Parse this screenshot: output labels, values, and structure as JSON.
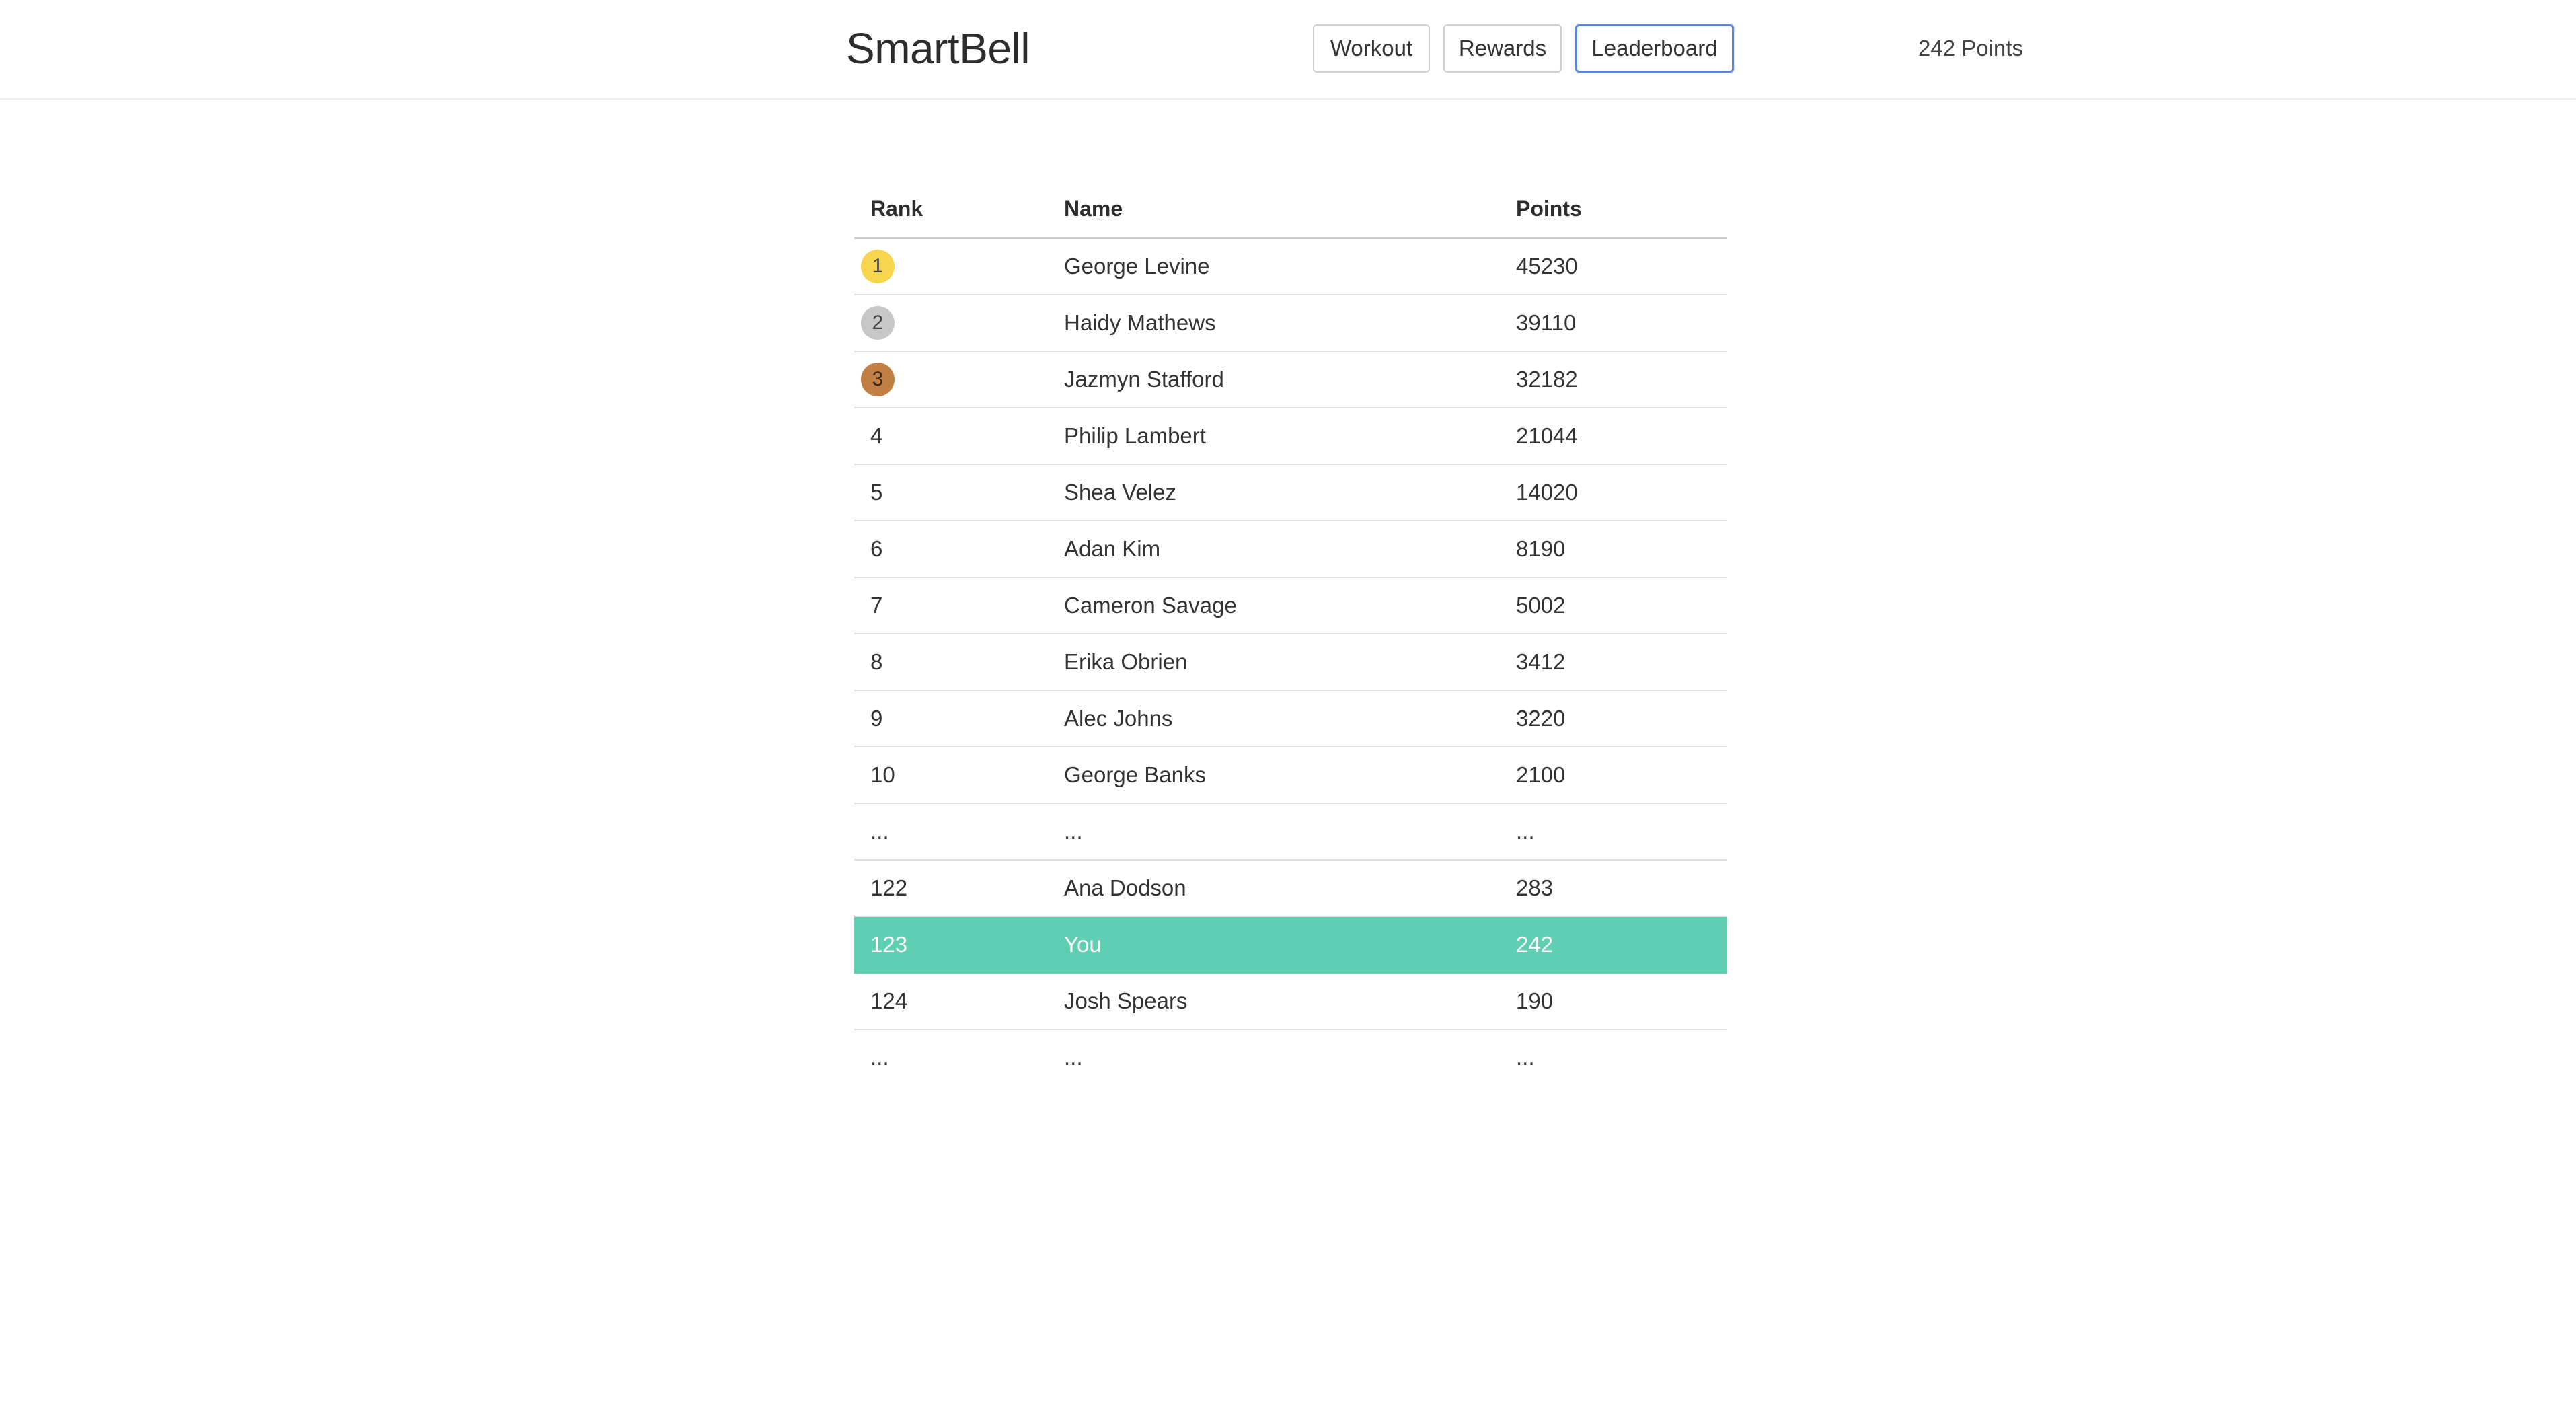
{
  "header": {
    "brand": "SmartBell",
    "nav": {
      "workout": "Workout",
      "rewards": "Rewards",
      "leaderboard": "Leaderboard"
    },
    "points_total": "242 Points"
  },
  "colors": {
    "highlight_row": "#5fcfb4",
    "active_tab_border": "#5b86d8",
    "gold": "#f7d64d",
    "silver": "#c7c7c7",
    "bronze": "#c27f43"
  },
  "table": {
    "headers": {
      "rank": "Rank",
      "name": "Name",
      "points": "Points"
    },
    "rows": [
      {
        "rank": "1",
        "name": "George Levine",
        "points": "45230",
        "medal": "gold"
      },
      {
        "rank": "2",
        "name": "Haidy Mathews",
        "points": "39110",
        "medal": "silver"
      },
      {
        "rank": "3",
        "name": "Jazmyn Stafford",
        "points": "32182",
        "medal": "bronze"
      },
      {
        "rank": "4",
        "name": "Philip Lambert",
        "points": "21044"
      },
      {
        "rank": "5",
        "name": "Shea Velez",
        "points": "14020"
      },
      {
        "rank": "6",
        "name": "Adan Kim",
        "points": "8190"
      },
      {
        "rank": "7",
        "name": "Cameron Savage",
        "points": "5002"
      },
      {
        "rank": "8",
        "name": "Erika Obrien",
        "points": "3412"
      },
      {
        "rank": "9",
        "name": "Alec Johns",
        "points": "3220"
      },
      {
        "rank": "10",
        "name": "George Banks",
        "points": "2100"
      },
      {
        "rank": "...",
        "name": "...",
        "points": "..."
      },
      {
        "rank": "122",
        "name": "Ana Dodson",
        "points": "283"
      },
      {
        "rank": "123",
        "name": "You",
        "points": "242",
        "highlight": true
      },
      {
        "rank": "124",
        "name": "Josh Spears",
        "points": "190"
      },
      {
        "rank": "...",
        "name": "...",
        "points": "..."
      }
    ]
  }
}
